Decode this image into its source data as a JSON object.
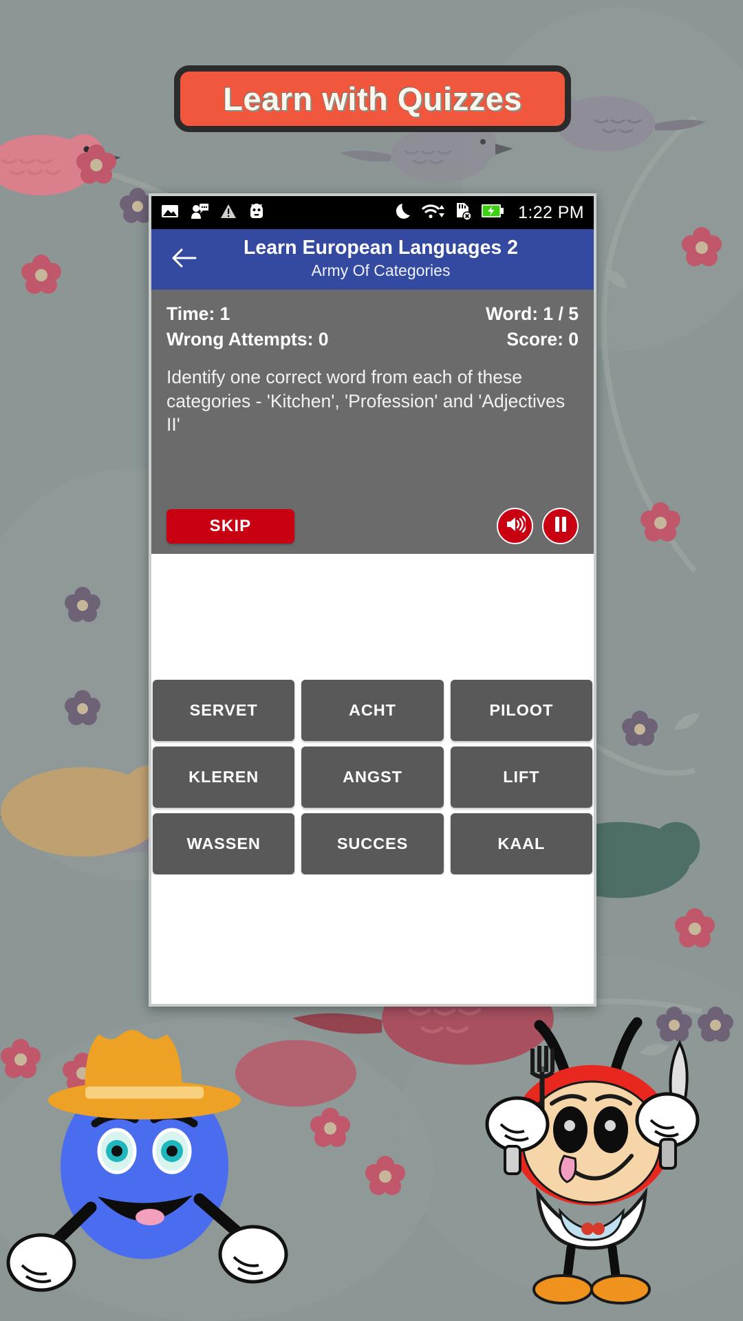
{
  "banner": {
    "text": "Learn with Quizzes",
    "bg_color": "#f0573c",
    "border_color": "#2b2b2b"
  },
  "statusbar": {
    "time": "1:22 PM",
    "left_icons": [
      "image-icon",
      "person-speaking-icon",
      "warning-icon",
      "android-robot-icon"
    ],
    "right_icons": [
      "do-not-disturb-moon-icon",
      "wifi-icon",
      "sd-card-removed-icon",
      "battery-charging-icon"
    ]
  },
  "appbar": {
    "back_icon": "back-arrow-icon",
    "title": "Learn European Languages 2",
    "subtitle": "Army Of Categories",
    "bg_color": "#344aa0"
  },
  "info": {
    "time_label": "Time: 1",
    "word_label": "Word: 1 / 5",
    "wrong_attempts_label": "Wrong Attempts: 0",
    "score_label": "Score: 0",
    "prompt": "Identify one correct word from each of these categories - 'Kitchen', 'Profession' and 'Adjectives II'",
    "skip_label": "SKIP",
    "sound_icon": "speaker-volume-icon",
    "pause_icon": "pause-icon",
    "card_bg": "#6b6b6b",
    "accent_red": "#c90012"
  },
  "words": [
    {
      "label": "SERVET"
    },
    {
      "label": "ACHT"
    },
    {
      "label": "PILOOT"
    },
    {
      "label": "KLEREN"
    },
    {
      "label": "ANGST"
    },
    {
      "label": "LIFT"
    },
    {
      "label": "WASSEN"
    },
    {
      "label": "SUCCES"
    },
    {
      "label": "KAAL"
    }
  ],
  "mascots": {
    "left": "blue-character-with-hat",
    "right": "red-character-with-fork-and-knife"
  }
}
